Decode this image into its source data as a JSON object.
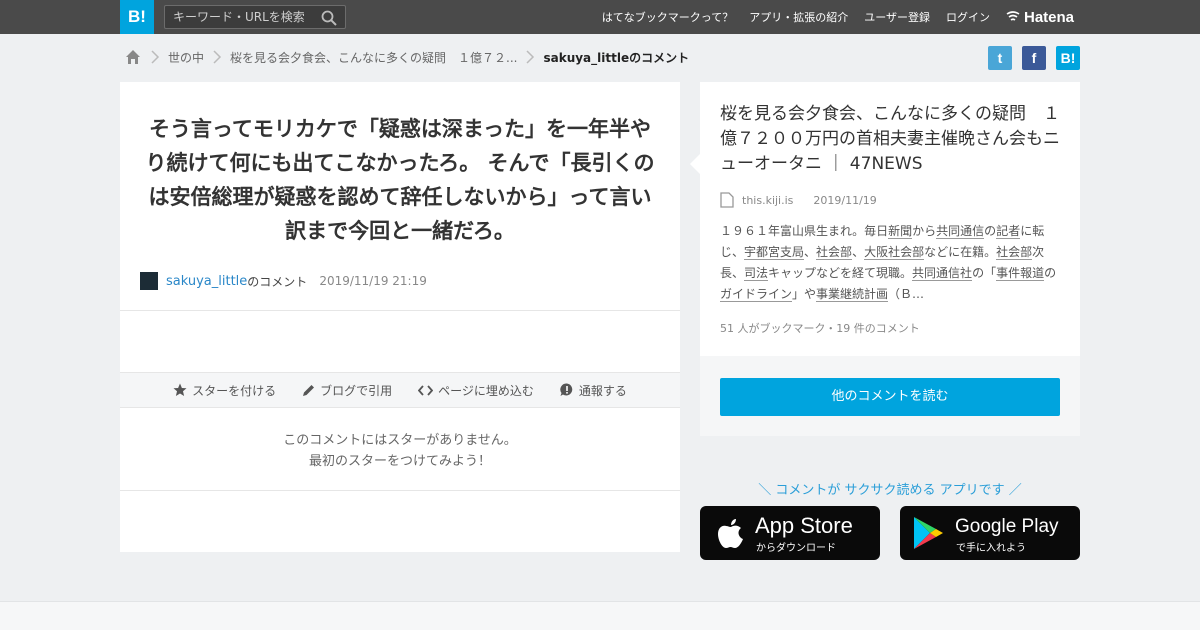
{
  "header": {
    "logo": "B!",
    "search_placeholder": "キーワード・URLを検索",
    "nav": [
      "はてなブックマークって？",
      "アプリ・拡張の紹介",
      "ユーザー登録",
      "ログイン"
    ],
    "brand": "Hatena"
  },
  "breadcrumb": {
    "items": [
      "世の中",
      "桜を見る会夕食会、こんなに多くの疑問　１億７２..."
    ],
    "current": "sakuya_littleのコメント"
  },
  "share": [
    "t",
    "f",
    "B!"
  ],
  "comment": {
    "text": "そう言ってモリカケで「疑惑は深まった」を一年半やり続けて何にも出てこなかったろ。 そんで「長引くのは安倍総理が疑惑を認めて辞任しないから」って言い訳まで今回と一緒だろ。",
    "user": "sakuya_little",
    "suffix": "のコメント",
    "datetime": "2019/11/19 21:19"
  },
  "actions": [
    "スターを付ける",
    "ブログで引用",
    "ページに埋め込む",
    "通報する"
  ],
  "no_star": {
    "line1": "このコメントにはスターがありません。",
    "line2": "最初のスターをつけてみよう！"
  },
  "entry": {
    "title": "桜を見る会夕食会、こんなに多くの疑問　１億７２００万円の首相夫妻主催晩さん会もニューオータニ ｜ 47NEWS",
    "domain": "this.kiji.is",
    "date": "2019/11/19",
    "desc_parts": [
      "１９６１年富山県生まれ。毎日",
      "新聞",
      "から",
      "共同通信",
      "の",
      "記者",
      "に転じ、",
      "宇都宮支局",
      "、",
      "社会部",
      "、",
      "大阪社会部",
      "などに在籍。",
      "社会部",
      "次長、",
      "司法",
      "キャップなどを経て現職。",
      "共同通信社",
      "の「",
      "事件報道",
      "の",
      "ガイドライン",
      "」や",
      "事業継続計画",
      "（Ｂ…"
    ],
    "count": "51 人がブックマーク・19 件のコメント",
    "more_button": "他のコメントを読む"
  },
  "promo": {
    "text": "＼ コメントが サクサク読める アプリです ／",
    "appstore_big": "App Store",
    "appstore_small": "からダウンロード",
    "gplay_big": "Google Play",
    "gplay_small": "で手に入れよう"
  },
  "colors": {
    "accent": "#00a4de",
    "topbar": "#4a4a4a",
    "link": "#2a87c8"
  }
}
